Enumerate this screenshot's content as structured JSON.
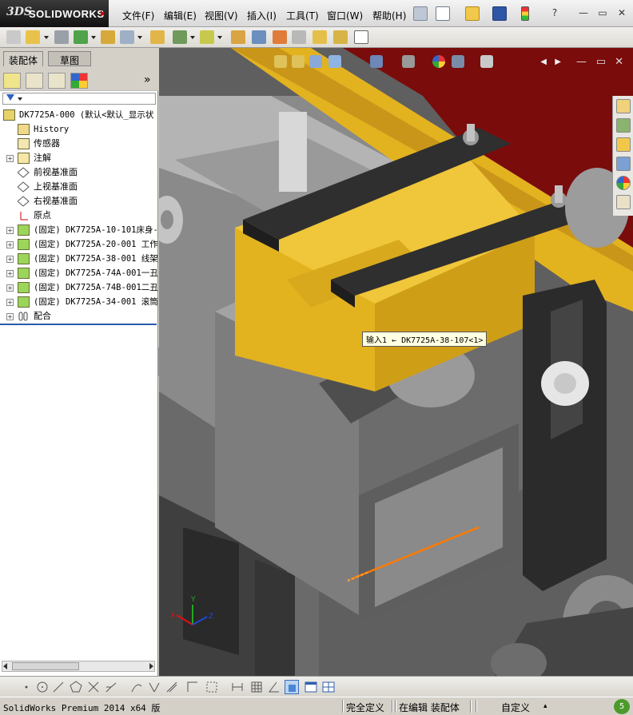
{
  "app": {
    "logo_ds": "3DS",
    "logo_name": "SOLIDWORKS"
  },
  "menu": [
    "文件(F)",
    "编辑(E)",
    "视图(V)",
    "插入(I)",
    "工具(T)",
    "窗口(W)",
    "帮助(H)"
  ],
  "window_controls": {
    "help": "?",
    "minimize": "—",
    "restore": "▭",
    "close": "✕"
  },
  "panel": {
    "tabs": [
      "装配体",
      "草图"
    ],
    "active_tab": "装配体",
    "expand_glyph": "»",
    "tree": [
      {
        "label": "DK7725A-000  (默认<默认_显示状",
        "icon": "assembly-icon",
        "expand": false,
        "indent": 0,
        "mono": true
      },
      {
        "label": "History",
        "icon": "history-icon",
        "expand": false,
        "indent": 1,
        "mono": true
      },
      {
        "label": "传感器",
        "icon": "sensor-icon",
        "expand": false,
        "indent": 1,
        "mono": false
      },
      {
        "label": "注解",
        "icon": "annotation-icon",
        "expand": true,
        "indent": 1,
        "mono": false
      },
      {
        "label": "前视基准面",
        "icon": "plane-icon",
        "expand": false,
        "indent": 1,
        "mono": false
      },
      {
        "label": "上视基准面",
        "icon": "plane-icon",
        "expand": false,
        "indent": 1,
        "mono": false
      },
      {
        "label": "右视基准面",
        "icon": "plane-icon",
        "expand": false,
        "indent": 1,
        "mono": false
      },
      {
        "label": "原点",
        "icon": "origin-icon",
        "expand": false,
        "indent": 1,
        "mono": false
      },
      {
        "label": "(固定) DK7725A-10-101床身-",
        "icon": "part-icon",
        "expand": true,
        "indent": 1,
        "mono": true
      },
      {
        "label": "(固定) DK7725A-20-001 工作",
        "icon": "part-icon",
        "expand": true,
        "indent": 1,
        "mono": true
      },
      {
        "label": "(固定) DK7725A-38-001 线架",
        "icon": "part-icon",
        "expand": true,
        "indent": 1,
        "mono": true
      },
      {
        "label": "(固定) DK7725A-74A-001一丑",
        "icon": "part-icon",
        "expand": true,
        "indent": 1,
        "mono": true
      },
      {
        "label": "(固定) DK7725A-74B-001二丑",
        "icon": "part-icon",
        "expand": true,
        "indent": 1,
        "mono": true
      },
      {
        "label": "(固定) DK7725A-34-001 滚筒",
        "icon": "part-icon",
        "expand": true,
        "indent": 1,
        "mono": true
      },
      {
        "label": "配合",
        "icon": "mates-icon",
        "expand": true,
        "indent": 1,
        "mono": false
      }
    ]
  },
  "viewport": {
    "tooltip": "输入1 ← DK7725A-38-107<1>",
    "triad": {
      "x": "X",
      "y": "Y",
      "z": "Z"
    }
  },
  "status": {
    "product": "SolidWorks Premium 2014 x64 版",
    "definition": "完全定义",
    "mode": "在编辑 装配体",
    "units": "自定义",
    "units_caret": "▴",
    "notifications": "5"
  },
  "colors": {
    "accent_red": "#c8102e",
    "yellow_part": "#e3b21f",
    "dark_part": "#3a3a3a",
    "gray_part": "#8c8c8c",
    "selection_orange": "#ff7a00",
    "background_red": "#7a0c0c"
  }
}
